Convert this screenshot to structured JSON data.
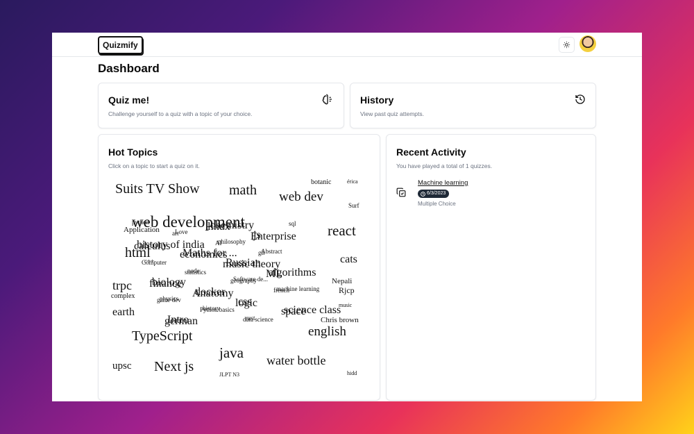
{
  "app": {
    "logo": "Quizmify"
  },
  "page": {
    "title": "Dashboard"
  },
  "quiz_card": {
    "title": "Quiz me!",
    "description": "Challenge yourself to a quiz with a topic of your choice."
  },
  "history_card": {
    "title": "History",
    "description": "View past quiz attempts."
  },
  "hot_topics": {
    "title": "Hot Topics",
    "description": "Click on a topic to start a quiz on it.",
    "words": [
      "Suits TV Show",
      "math",
      "botanic",
      "érica",
      "web dev",
      "Surf",
      "web development",
      "react",
      "Application",
      "html",
      "cats",
      "trpc",
      "Nepali",
      "complex",
      "Rjcp",
      "earth",
      "music",
      "TypeScript",
      "english",
      "Chris brown",
      "java",
      "upsc",
      "Next js",
      "water bottle",
      "JLPT N3",
      "hidd",
      "python",
      "Maths for ...",
      "Software de...",
      "science class",
      "Love",
      "Russian",
      "machine learning",
      "Intro",
      "philosophy",
      "algorithms",
      "physics",
      "chemistry",
      "Abstract",
      "biology",
      "history",
      "js",
      "c++",
      "docker",
      "rust",
      "history of india",
      "node",
      "css",
      "sql",
      "economics",
      "geography",
      "space",
      "art",
      "music theory",
      "french",
      "german",
      "AI",
      "ML",
      "game dev",
      "linux",
      "git",
      "finance",
      "Python basics",
      "Enterprise",
      "Computer",
      "Anatomy",
      "data science",
      "calculus",
      "statistics",
      "logic"
    ]
  },
  "recent_activity": {
    "title": "Recent Activity",
    "description": "You have played a total of 1 quizzes.",
    "items": [
      {
        "topic": "Machine learning",
        "date": "6/3/2023",
        "type": "Multiple Choice"
      }
    ]
  },
  "icons": {
    "theme": "sun-icon",
    "quiz": "brain-icon",
    "history": "history-icon",
    "activity": "copy-check-icon",
    "clock": "clock-icon"
  }
}
